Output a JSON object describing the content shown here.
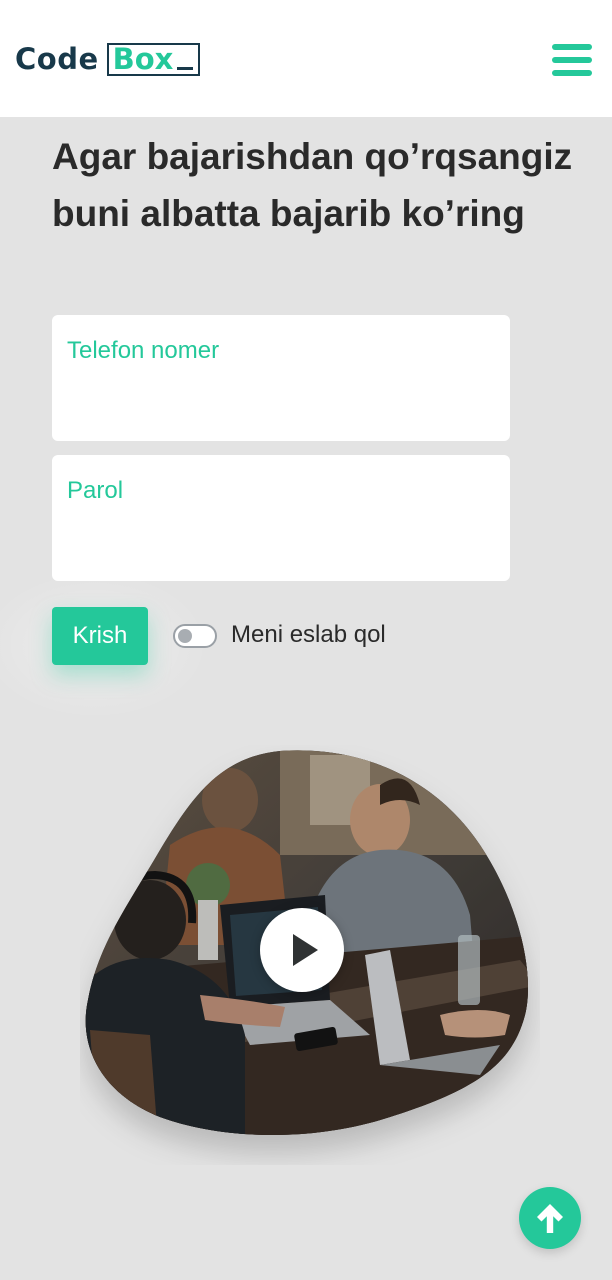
{
  "header": {
    "logo": {
      "code": "Code",
      "box": "Box"
    },
    "menu_icon": "hamburger-menu-icon"
  },
  "hero": {
    "heading": "Agar bajarishdan qo’rqsangiz buni albatta bajarib ko’ring"
  },
  "form": {
    "phone_placeholder": "Telefon nomer",
    "password_placeholder": "Parol",
    "submit_label": "Krish",
    "remember_label": "Meni eslab qol",
    "remember_checked": false
  },
  "media": {
    "play_icon": "play-icon"
  },
  "scroll_top_icon": "arrow-up-icon",
  "colors": {
    "accent": "#24c89a",
    "brand_dark": "#18394a",
    "background": "#e3e3e3",
    "text": "#2a2a2a"
  }
}
